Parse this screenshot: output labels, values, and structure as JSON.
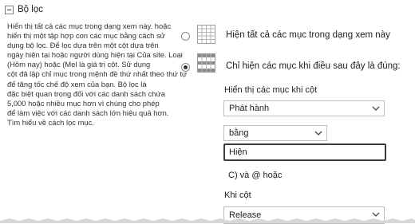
{
  "filter": {
    "title": "Bộ lọc",
    "description": "Hiển thị tất cả các mục trong dạng xem này. hoặc\nhiển thị một tập hợp con các mục bằng cách sử\ndụng bộ lọc. Để lọc dựa trên một cột dựa trên\nngày hiện tại hoặc người dùng hiện tại Của site. Loại\n(Hôm nay) hoặc (Mel là giá trị cột. Sử dụng\ncột đã lập chỉ mục trong mệnh đề thứ nhất theo thứ tự\nđể tăng tốc chế độ xem của bạn. Bộ lọc là\nđặc biệt quan trọng đối với các danh sách chứa\n5,000 hoặc nhiều mục hơn vì chúng cho phép\nđể làm việc với các danh sách lớn hiệu quả hơn.\nTìm hiểu về cách lọc mục.",
    "options": {
      "show_all_label": "Hiện tất cả các mục trong dạng xem này",
      "show_when_label": "Chỉ hiện các mục khi điều sau đây là đúng:"
    },
    "selected_option": "show_when",
    "show_when_column_label": "Hiển thị các mục khi cột",
    "column_select_value": "Phát hành",
    "operator_select_value": "bằng",
    "value_input": "Hiện",
    "and_or_label": "C) và @ hoặc",
    "second_column_label": "Khi cột",
    "second_column_select_value": "Release"
  }
}
